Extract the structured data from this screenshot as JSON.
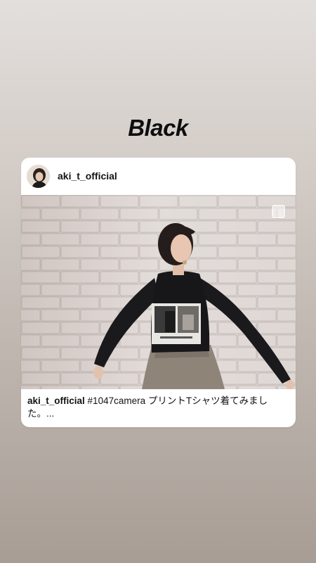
{
  "story": {
    "title": "Black"
  },
  "post": {
    "username": "aki_t_official",
    "caption_user": "aki_t_official",
    "caption_text": " #1047camera プリントTシャツ着てみました。...",
    "image_icon": "person-photo",
    "select_icon": "checkbox-square-icon"
  },
  "colors": {
    "background_top": "#e3dfdd",
    "background_bottom": "#a79d95",
    "card": "#ffffff",
    "text": "#141414"
  }
}
